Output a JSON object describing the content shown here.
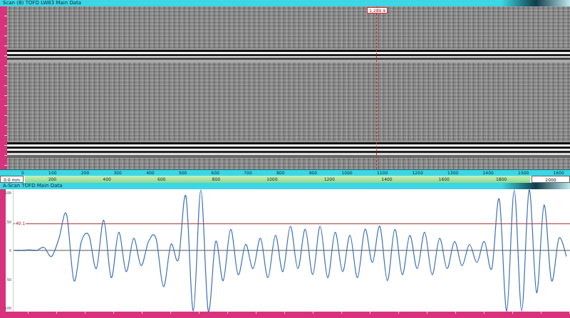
{
  "bscan": {
    "title": "Scan (B) TOFD LW83 Main Data",
    "cursor": {
      "label": "1,289.9",
      "level": 0.656
    },
    "scan_axis": {
      "ticks": [
        "0",
        "100",
        "200",
        "300",
        "400",
        "500",
        "600",
        "700",
        "800",
        "900",
        "1000",
        "1100",
        "1200",
        "1300",
        "1400",
        "1500",
        "1600"
      ]
    },
    "index_bar": {
      "start": "0.0 mm",
      "ticks": [
        "200",
        "400",
        "600",
        "800",
        "1000",
        "1200",
        "1400",
        "1600",
        "1800"
      ],
      "end": "2000"
    }
  },
  "ascan": {
    "title": "A-Scan TOFD Main Data",
    "axis": {
      "ticks": [
        "100",
        "50",
        "0",
        "-50",
        "-100"
      ]
    },
    "gate": {
      "label": "40.1",
      "value": 44
    },
    "series": {
      "values": [
        0,
        0,
        1,
        0,
        5,
        -10,
        20,
        60,
        -50,
        15,
        25,
        -30,
        50,
        -45,
        30,
        -35,
        20,
        -25,
        15,
        20,
        -60,
        10,
        -15,
        90,
        -100,
        100,
        -100,
        15,
        -50,
        35,
        -40,
        10,
        -30,
        20,
        -45,
        25,
        -35,
        40,
        -30,
        35,
        -40,
        40,
        -45,
        30,
        -35,
        25,
        -45,
        35,
        -20,
        40,
        -50,
        35,
        -40,
        25,
        -30,
        30,
        -40,
        20,
        -30,
        15,
        -25,
        10,
        -20,
        15,
        -30,
        85,
        -100,
        100,
        -100,
        100,
        -70,
        75,
        -50,
        20,
        -10
      ]
    }
  }
}
